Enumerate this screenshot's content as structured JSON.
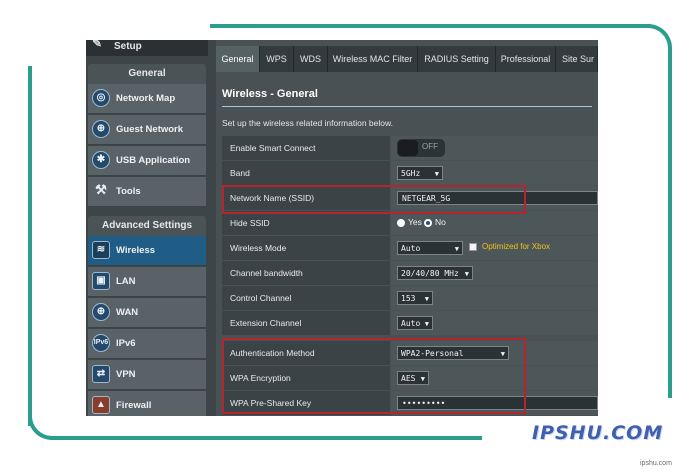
{
  "sidebar": {
    "setup_label": "Setup",
    "general_header": "General",
    "general_items": [
      {
        "label": "Network Map",
        "icon": "network-map-icon"
      },
      {
        "label": "Guest Network",
        "icon": "globe-icon"
      },
      {
        "label": "USB Application",
        "icon": "puzzle-icon"
      },
      {
        "label": "Tools",
        "icon": "wrench-icon"
      }
    ],
    "advanced_header": "Advanced Settings",
    "advanced_items": [
      {
        "label": "Wireless",
        "icon": "wifi-icon"
      },
      {
        "label": "LAN",
        "icon": "lan-icon"
      },
      {
        "label": "WAN",
        "icon": "wan-globe-icon"
      },
      {
        "label": "IPv6",
        "icon": "ipv6-icon"
      },
      {
        "label": "VPN",
        "icon": "vpn-icon"
      },
      {
        "label": "Firewall",
        "icon": "firewall-icon"
      }
    ]
  },
  "tabs": [
    "General",
    "WPS",
    "WDS",
    "Wireless MAC Filter",
    "RADIUS Setting",
    "Professional",
    "Site Sur"
  ],
  "page": {
    "title": "Wireless - General",
    "description": "Set up the wireless related information below."
  },
  "form": {
    "smart_connect": {
      "label": "Enable Smart Connect",
      "state": "OFF"
    },
    "band": {
      "label": "Band",
      "value": "5GHz"
    },
    "ssid": {
      "label": "Network Name (SSID)",
      "value": "NETGEAR_5G"
    },
    "hide_ssid": {
      "label": "Hide SSID",
      "yes": "Yes",
      "no": "No"
    },
    "wireless_mode": {
      "label": "Wireless Mode",
      "value": "Auto",
      "xbox_label": "Optimized for Xbox"
    },
    "channel_bandwidth": {
      "label": "Channel bandwidth",
      "value": "20/40/80 MHz"
    },
    "control_channel": {
      "label": "Control Channel",
      "value": "153"
    },
    "extension_channel": {
      "label": "Extension Channel",
      "value": "Auto"
    },
    "auth_method": {
      "label": "Authentication Method",
      "value": "WPA2-Personal"
    },
    "wpa_encryption": {
      "label": "WPA Encryption",
      "value": "AES"
    },
    "psk": {
      "label": "WPA Pre-Shared Key",
      "value": "•••••••••"
    }
  },
  "watermark": "IPSHU.COM",
  "site_credit": "ipshu.com",
  "colors": {
    "frame": "#2a9d8f",
    "highlight": "#b3262e",
    "active_nav": "#1f5d86"
  }
}
